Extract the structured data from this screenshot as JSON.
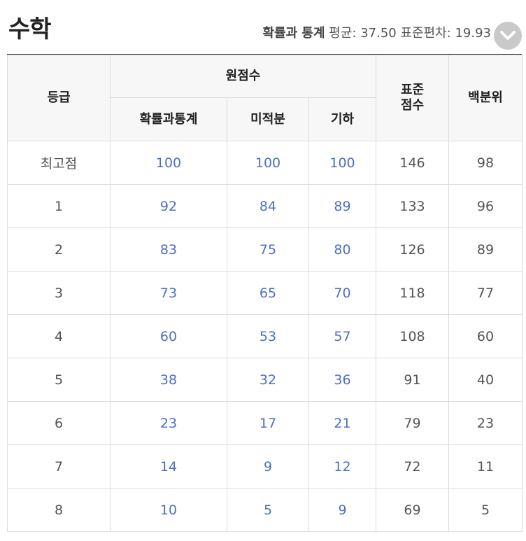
{
  "header": {
    "title": "수학",
    "stats_subject": "확률과 통계",
    "stats_text": " 평균: 37.50 표준편차: 19.93",
    "toggle_icon": "chevron-down-icon"
  },
  "table": {
    "headers": {
      "grade": "등급",
      "raw_score": "원점수",
      "standard_score_line1": "표준",
      "standard_score_line2": "점수",
      "percentile": "백분위",
      "sub_prob_stats": "확률과통계",
      "sub_calculus": "미적분",
      "sub_geometry": "기하"
    },
    "rows": [
      {
        "grade": "최고점",
        "prob": "100",
        "calc": "100",
        "geom": "100",
        "standard": "146",
        "percentile": "98"
      },
      {
        "grade": "1",
        "prob": "92",
        "calc": "84",
        "geom": "89",
        "standard": "133",
        "percentile": "96"
      },
      {
        "grade": "2",
        "prob": "83",
        "calc": "75",
        "geom": "80",
        "standard": "126",
        "percentile": "89"
      },
      {
        "grade": "3",
        "prob": "73",
        "calc": "65",
        "geom": "70",
        "standard": "118",
        "percentile": "77"
      },
      {
        "grade": "4",
        "prob": "60",
        "calc": "53",
        "geom": "57",
        "standard": "108",
        "percentile": "60"
      },
      {
        "grade": "5",
        "prob": "38",
        "calc": "32",
        "geom": "36",
        "standard": "91",
        "percentile": "40"
      },
      {
        "grade": "6",
        "prob": "23",
        "calc": "17",
        "geom": "21",
        "standard": "79",
        "percentile": "23"
      },
      {
        "grade": "7",
        "prob": "14",
        "calc": "9",
        "geom": "12",
        "standard": "72",
        "percentile": "11"
      },
      {
        "grade": "8",
        "prob": "10",
        "calc": "5",
        "geom": "9",
        "standard": "69",
        "percentile": "5"
      }
    ]
  },
  "colors": {
    "raw_score_text": "#4e6fc4",
    "header_bg": "#f7f7f7",
    "border": "#dcdcdc"
  }
}
